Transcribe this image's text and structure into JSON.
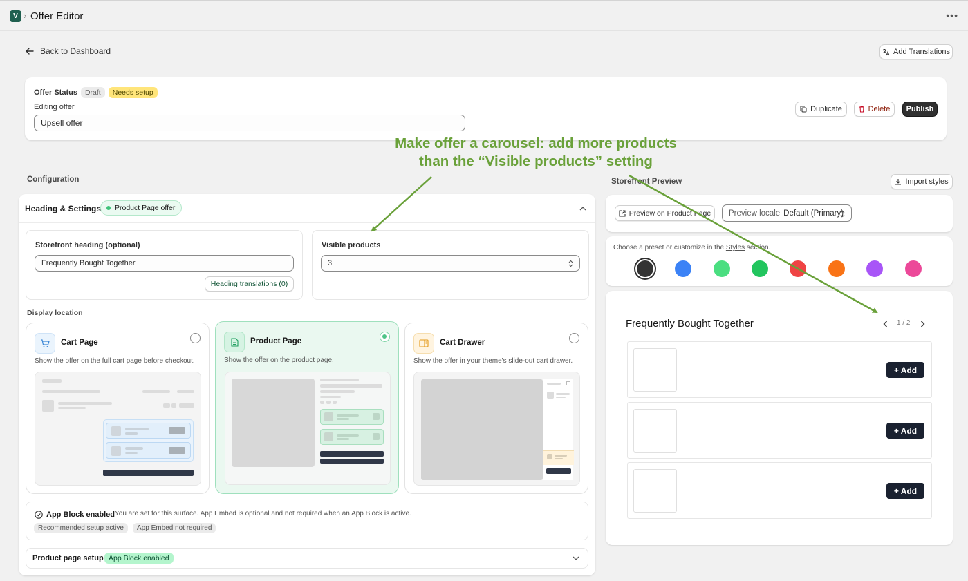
{
  "topbar": {
    "logo_glyph": "V",
    "separator": "›",
    "title": "Offer Editor",
    "more_icon": "ellipsis-icon"
  },
  "nav": {
    "back_label": "Back to Dashboard",
    "add_translations_label": "Add Translations"
  },
  "status_card": {
    "status_label": "Offer Status",
    "draft_badge": "Draft",
    "setup_badge": "Needs setup",
    "editing_label": "Editing offer",
    "offer_name": "Upsell offer",
    "duplicate_label": "Duplicate",
    "delete_label": "Delete",
    "publish_label": "Publish"
  },
  "annotation": {
    "line1": "Make offer a carousel: add more products",
    "line2": "than the “Visible products” setting",
    "color": "#6aa13a"
  },
  "configuration": {
    "label": "Configuration",
    "heading_settings": {
      "title": "Heading & Settings",
      "badge": "Product Page offer"
    },
    "storefront_heading": {
      "label": "Storefront heading (optional)",
      "value": "Frequently Bought Together",
      "translations_button": "Heading translations (0)"
    },
    "visible_products": {
      "label": "Visible products",
      "value": "3"
    },
    "display_location": {
      "label": "Display location",
      "options": [
        {
          "title": "Cart Page",
          "description": "Show the offer on the full cart page before checkout.",
          "selected": false
        },
        {
          "title": "Product Page",
          "description": "Show the offer on the product page.",
          "selected": true
        },
        {
          "title": "Cart Drawer",
          "description": "Show the offer in your theme's slide-out cart drawer.",
          "selected": false
        }
      ]
    },
    "app_block": {
      "title": "App Block enabled",
      "description": "You are set for this surface. App Embed is optional and not required when an App Block is active.",
      "tags": [
        "Recommended setup active",
        "App Embed not required"
      ]
    },
    "product_page_setup": {
      "title": "Product page setup",
      "badge": "App Block enabled"
    }
  },
  "preview": {
    "label": "Storefront Preview",
    "import_styles_label": "Import styles",
    "preview_button": "Preview on Product Page",
    "locale_label": "Preview locale",
    "locale_value": "Default (Primary)",
    "preset_text_before": "Choose a preset or customize in the",
    "preset_link": "Styles",
    "preset_text_after": "section.",
    "swatches": [
      "#333333",
      "#3b82f6",
      "#4ade80",
      "#22c55e",
      "#ef4444",
      "#f97316",
      "#a855f7",
      "#ec4899"
    ],
    "widget": {
      "title": "Frequently Bought Together",
      "pager": "1 / 2",
      "add_label": "+ Add",
      "rows": 3
    }
  }
}
